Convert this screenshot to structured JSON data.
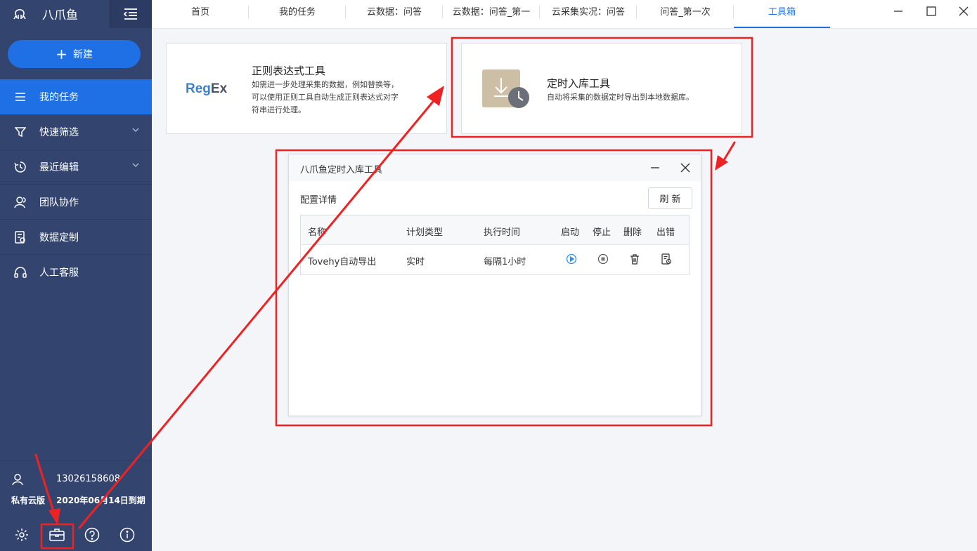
{
  "app": {
    "name": "八爪鱼"
  },
  "sidebar": {
    "new_label": "新建",
    "items": [
      {
        "label": "我的任务",
        "icon": "list-icon"
      },
      {
        "label": "快速筛选",
        "icon": "filter-icon"
      },
      {
        "label": "最近编辑",
        "icon": "recent-icon"
      },
      {
        "label": "团队协作",
        "icon": "team-icon"
      },
      {
        "label": "数据定制",
        "icon": "data-custom-icon"
      },
      {
        "label": "人工客服",
        "icon": "headset-icon"
      }
    ],
    "user": {
      "phone": "13026158608",
      "plan": "私有云版",
      "expire": "2020年06月14日到期"
    }
  },
  "tabs": [
    {
      "label": "首页"
    },
    {
      "label": "我的任务"
    },
    {
      "label": "云数据：问答"
    },
    {
      "label": "云数据：问答_第一"
    },
    {
      "label": "云采集实况：问答"
    },
    {
      "label": "问答_第一次"
    },
    {
      "label": "工具箱"
    }
  ],
  "tools": {
    "regex": {
      "logo_a": "Reg",
      "logo_b": "Ex",
      "title": "正则表达式工具",
      "desc_1": "如需进一步处理采集的数据，例如替换等，",
      "desc_2": "可以使用正则工具自动生成正则表达式对字",
      "desc_3": "符串进行处理。"
    },
    "schedule": {
      "title": "定时入库工具",
      "desc": "自动将采集的数据定时导出到本地数据库。"
    }
  },
  "dialog": {
    "title": "八爪鱼定时入库工具",
    "section_label": "配置详情",
    "refresh_label": "刷 新",
    "columns": [
      "名称",
      "计划类型",
      "执行时间",
      "启动",
      "停止",
      "删除",
      "出错"
    ],
    "rows": [
      {
        "name": "Tovehy自动导出",
        "plan_type": "实时",
        "exec_time": "每隔1小时"
      }
    ]
  },
  "colors": {
    "sidebar": "#33456e",
    "accent": "#1f6fe5",
    "annotation": "#ee2222"
  }
}
